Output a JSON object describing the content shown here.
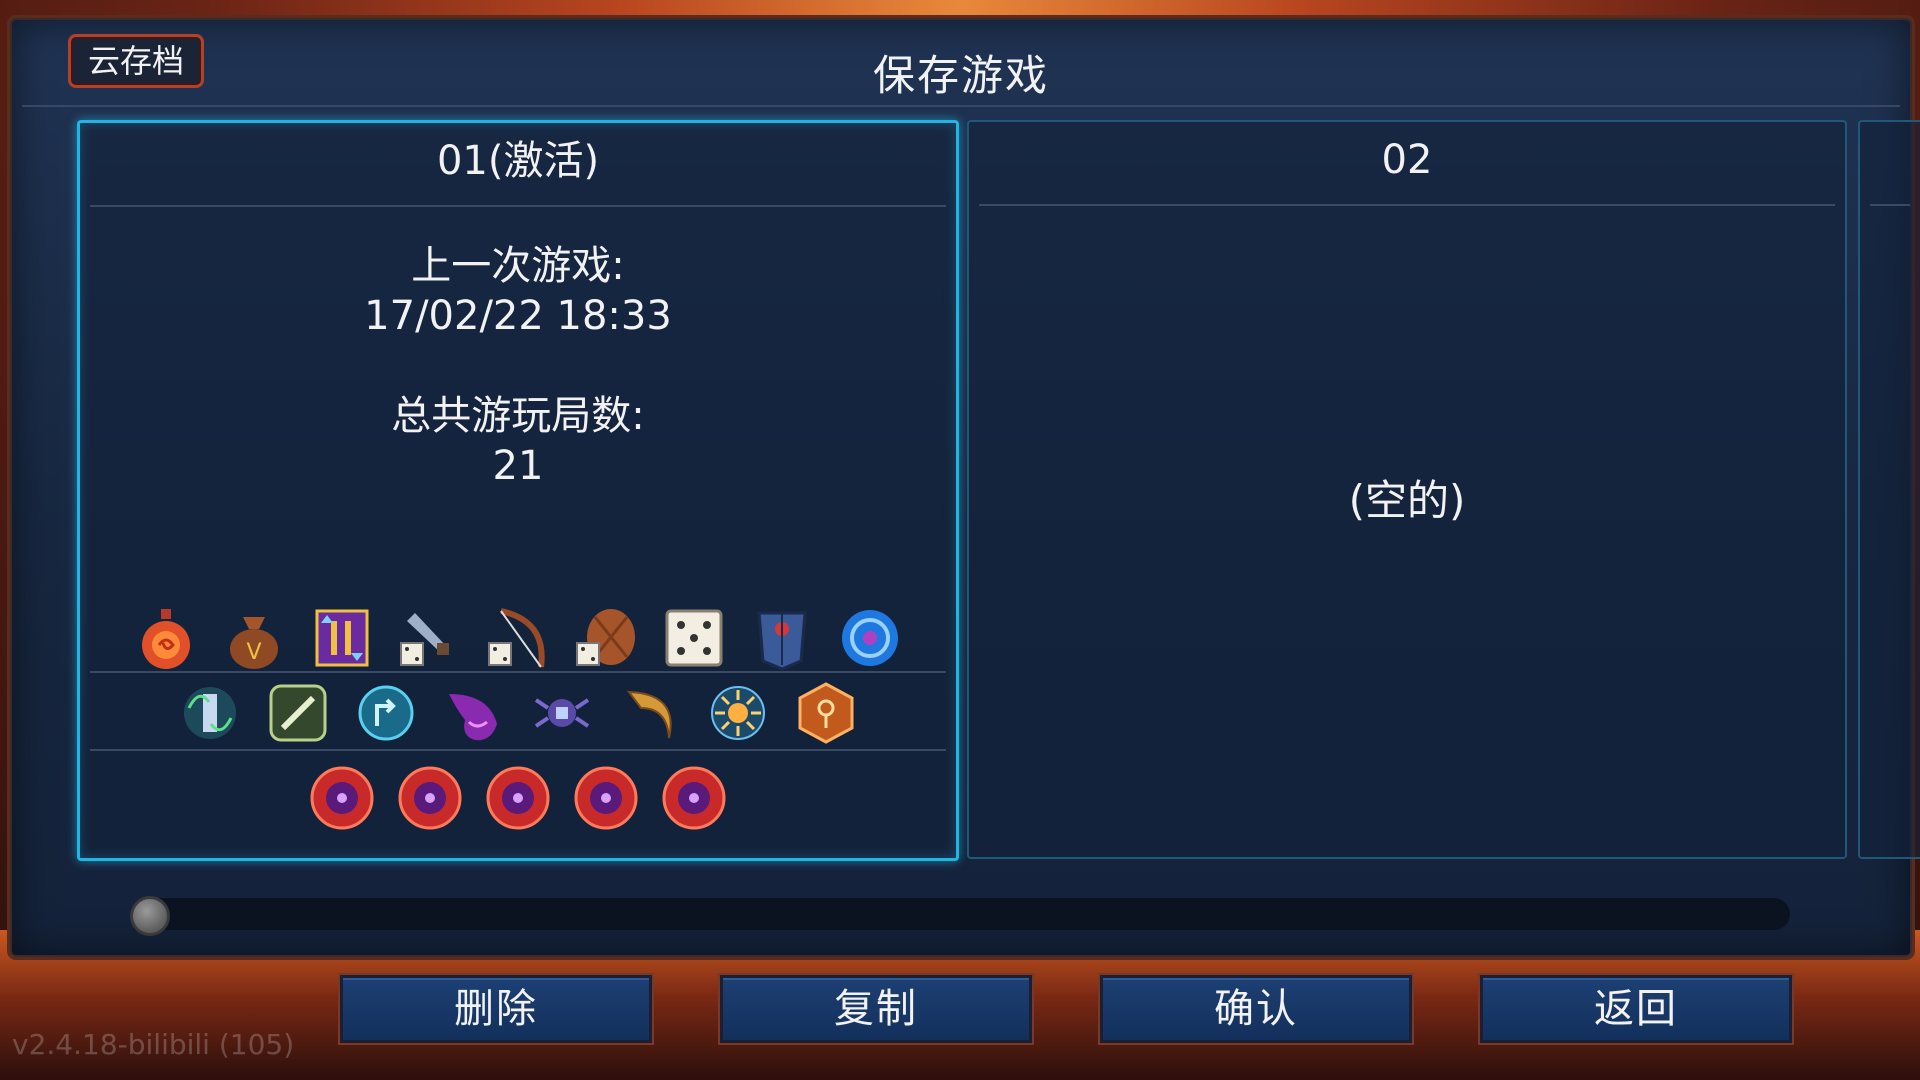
{
  "header": {
    "title": "保存游戏",
    "cloud_save_label": "云存档"
  },
  "slots": [
    {
      "name": "01(激活)",
      "active": true,
      "last_played_label": "上一次游戏:",
      "last_played_value": "17/02/22  18:33",
      "total_runs_label": "总共游玩局数:",
      "total_runs_value": "21",
      "icons_row1": [
        "potion-flask-icon",
        "money-bag-icon",
        "upgrade-scroll-icon",
        "dagger-dice-icon",
        "bow-dice-icon",
        "shield-dice-icon",
        "dice-icon",
        "armor-vest-icon",
        "blue-orb-icon"
      ],
      "icons_row2": [
        "vine-rune-icon",
        "wrench-rune-icon",
        "teleport-rune-icon",
        "purple-flame-icon",
        "spider-rune-icon",
        "horn-icon",
        "spider-sun-icon",
        "key-rune-icon"
      ],
      "icons_row3": [
        "boss-cell-icon",
        "boss-cell-icon",
        "boss-cell-icon",
        "boss-cell-icon",
        "boss-cell-icon"
      ]
    },
    {
      "name": "02",
      "active": false,
      "empty_label": "(空的)"
    }
  ],
  "scrollbar": {
    "position": 0
  },
  "actions": {
    "delete_label": "删除",
    "copy_label": "复制",
    "confirm_label": "确认",
    "back_label": "返回"
  },
  "footer": {
    "version": "v2.4.18-bilibili (105)"
  },
  "colors": {
    "active_border": "#1fb6e6",
    "panel_bg": "#1a2b47",
    "button_bg": "#173a6a",
    "button_border": "#7a3826"
  }
}
